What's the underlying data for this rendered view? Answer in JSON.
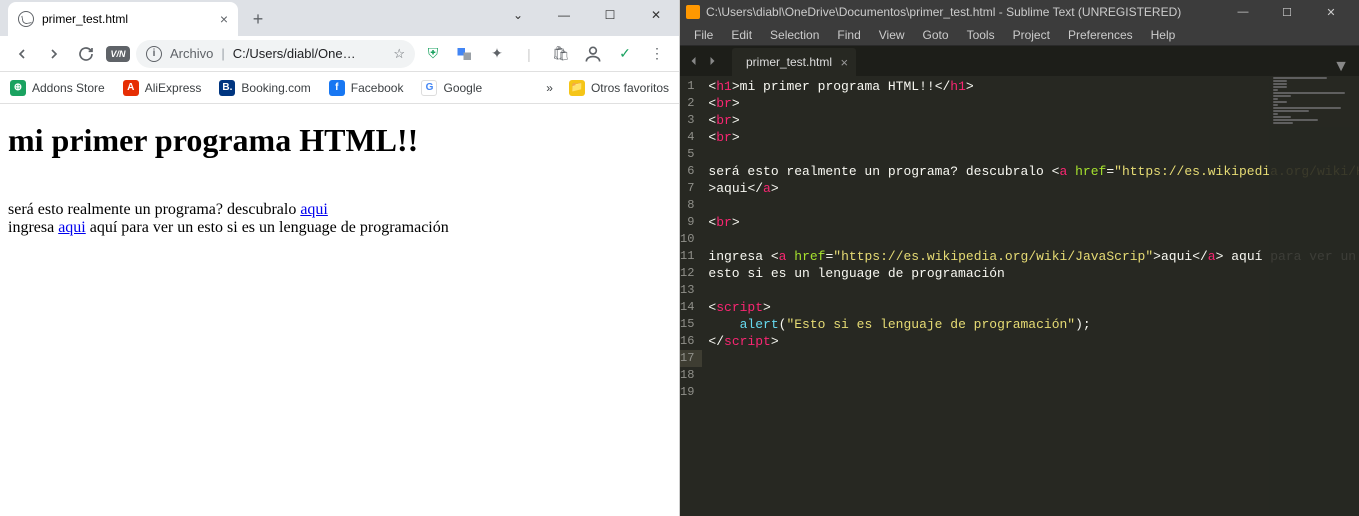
{
  "chrome": {
    "tab_title": "primer_test.html",
    "addrbar": {
      "label": "Archivo",
      "url": "C:/Users/diabl/One…"
    },
    "bookmarks": {
      "addons": "Addons Store",
      "aliexpress": "AliExpress",
      "booking": "Booking.com",
      "facebook": "Facebook",
      "google": "Google",
      "more": "»",
      "otros": "Otros favoritos"
    },
    "page": {
      "h1": "mi primer programa HTML!!",
      "line1_a": "será esto realmente un programa? descubralo ",
      "link1": "aqui",
      "line2_a": "ingresa ",
      "link2": "aqui",
      "line2_b": " aquí para ver un esto si es un lenguage de programación"
    }
  },
  "sublime": {
    "title": "C:\\Users\\diabl\\OneDrive\\Documentos\\primer_test.html - Sublime Text (UNREGISTERED)",
    "menu": {
      "file": "File",
      "edit": "Edit",
      "selection": "Selection",
      "find": "Find",
      "view": "View",
      "goto": "Goto",
      "tools": "Tools",
      "project": "Project",
      "preferences": "Preferences",
      "help": "Help"
    },
    "tab": "primer_test.html",
    "line_numbers": [
      "1",
      "2",
      "3",
      "4",
      "5",
      "6",
      "7",
      "8",
      "9",
      "10",
      "11",
      "12",
      "13",
      "14",
      "15",
      "16",
      "17",
      "18",
      "19"
    ],
    "code": {
      "l1_t1": "<",
      "l1_tag1": "h1",
      "l1_t2": ">",
      "l1_txt": "mi primer programa HTML!!",
      "l1_t3": "</",
      "l1_tag2": "h1",
      "l1_t4": ">",
      "l2_t1": "<",
      "l2_tag": "br",
      "l2_t2": ">",
      "l3_t1": "<",
      "l3_tag": "br",
      "l3_t2": ">",
      "l4_t1": "<",
      "l4_tag": "br",
      "l4_t2": ">",
      "l6_txt": "será esto realmente un programa? descubralo ",
      "l6_t1": "<",
      "l6_tag": "a",
      "l6_sp": " ",
      "l6_attr": "href",
      "l6_eq": "=",
      "l6_str": "\"https://es.wikipedia.org/wiki/HTML\"",
      "l6b_t1": ">",
      "l6b_txt": "aqui",
      "l6b_t2": "</",
      "l6b_tag": "a",
      "l6b_t3": ">",
      "l8_t1": "<",
      "l8_tag": "br",
      "l8_t2": ">",
      "l10_txt": "ingresa ",
      "l10_t1": "<",
      "l10_tag": "a",
      "l10_sp": " ",
      "l10_attr": "href",
      "l10_eq": "=",
      "l10_str": "\"https://es.wikipedia.org/wiki/JavaScrip\"",
      "l10_t2": ">",
      "l10_txt2": "aqui",
      "l10_t3": "</",
      "l10_tag2": "a",
      "l10_t4": ">",
      "l10_txt3": " aquí para ver un",
      "l10b_txt": "esto si es un lenguage de programación",
      "l13_t1": "<",
      "l13_tag": "script",
      "l13_t2": ">",
      "l14_indent": "    ",
      "l14_fn": "alert",
      "l14_p1": "(",
      "l14_str": "\"Esto si es lenguaje de programación\"",
      "l14_p2": ");",
      "l15_t1": "</",
      "l15_tag": "script",
      "l15_t2": ">"
    }
  }
}
